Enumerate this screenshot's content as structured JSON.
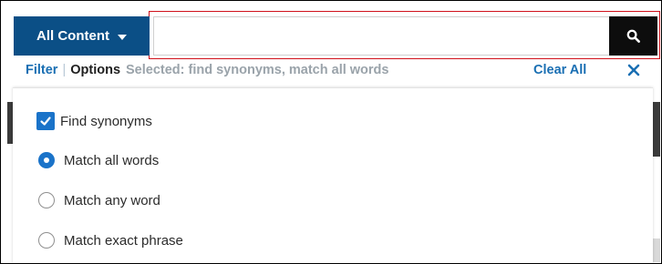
{
  "search": {
    "scope_label": "All Content",
    "query": "",
    "placeholder": ""
  },
  "options_bar": {
    "filter_label": "Filter",
    "separator": "|",
    "options_label": "Options",
    "selected_summary": "Selected: find synonyms, match all words",
    "clear_all_label": "Clear All"
  },
  "options": {
    "find_synonyms": {
      "label": "Find synonyms",
      "checked": true
    },
    "radios": [
      {
        "label": "Match all words",
        "selected": true
      },
      {
        "label": "Match any word",
        "selected": false
      },
      {
        "label": "Match exact phrase",
        "selected": false
      }
    ]
  },
  "colors": {
    "scope_button_bg": "#0b4f86",
    "link_blue": "#1a6fb3",
    "control_blue": "#1a73c9",
    "search_button_bg": "#0d0d0d",
    "highlight_border": "#d0111b"
  },
  "icons": {
    "search_button": "search-icon",
    "dropdown": "caret-down-icon",
    "close": "close-icon",
    "checkbox": "checkmark-icon"
  }
}
